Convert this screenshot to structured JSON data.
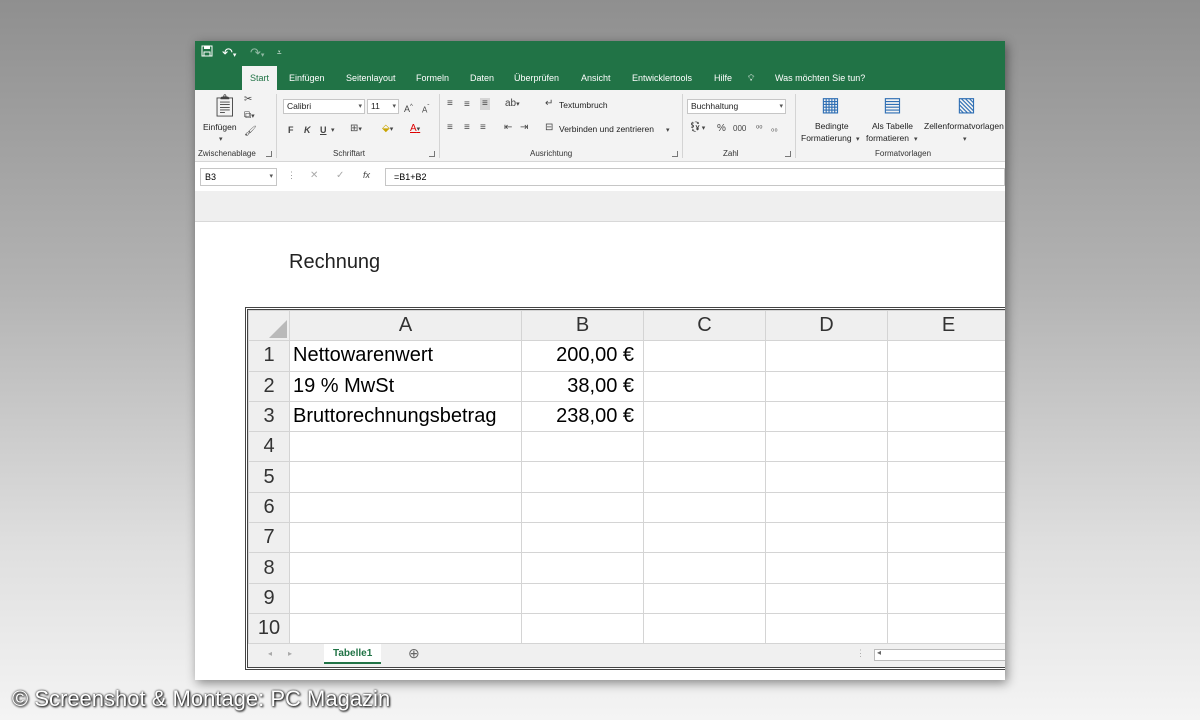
{
  "quick_access": {
    "save_icon": "save-icon",
    "undo_icon": "undo-icon",
    "redo_icon": "redo-icon",
    "customize_icon": "customize-icon"
  },
  "tabs": [
    {
      "label": "Start",
      "active": true
    },
    {
      "label": "Einfügen"
    },
    {
      "label": "Seitenlayout"
    },
    {
      "label": "Formeln"
    },
    {
      "label": "Daten"
    },
    {
      "label": "Überprüfen"
    },
    {
      "label": "Ansicht"
    },
    {
      "label": "Entwicklertools"
    },
    {
      "label": "Hilfe"
    }
  ],
  "tell_me": "Was möchten Sie tun?",
  "ribbon": {
    "clipboard": {
      "paste_label": "Einfügen",
      "group_label": "Zwischenablage"
    },
    "font": {
      "name": "Calibri",
      "size": "11",
      "bold": "F",
      "italic": "K",
      "underline": "U",
      "group_label": "Schriftart"
    },
    "alignment": {
      "wrap_label": "Textumbruch",
      "merge_label": "Verbinden und zentrieren",
      "group_label": "Ausrichtung"
    },
    "number": {
      "format": "Buchhaltung",
      "percent": "%",
      "thousands": "000",
      "group_label": "Zahl"
    },
    "styles": {
      "cond_format_line1": "Bedingte",
      "cond_format_line2": "Formatierung",
      "table_line1": "Als Tabelle",
      "table_line2": "formatieren",
      "cell_styles": "Zellenformatvorlagen",
      "group_label": "Formatvorlagen"
    }
  },
  "formula_bar": {
    "name_box": "B3",
    "cancel": "✕",
    "enter": "✓",
    "fx": "fx",
    "formula": "=B1+B2"
  },
  "document_title": "Rechnung",
  "sheet": {
    "columns": [
      "A",
      "B",
      "C",
      "D",
      "E"
    ],
    "rows": [
      {
        "n": "1",
        "a": "Nettowarenwert",
        "b": "200,00 €"
      },
      {
        "n": "2",
        "a": "19 % MwSt",
        "b": "38,00 €"
      },
      {
        "n": "3",
        "a": "Bruttorechnungsbetrag",
        "b": "238,00 €"
      },
      {
        "n": "4",
        "a": "",
        "b": ""
      },
      {
        "n": "5",
        "a": "",
        "b": ""
      },
      {
        "n": "6",
        "a": "",
        "b": ""
      },
      {
        "n": "7",
        "a": "",
        "b": ""
      },
      {
        "n": "8",
        "a": "",
        "b": ""
      },
      {
        "n": "9",
        "a": "",
        "b": ""
      },
      {
        "n": "10",
        "a": "",
        "b": ""
      }
    ],
    "active_tab": "Tabelle1",
    "add_sheet": "⊕"
  },
  "copyright": "© Screenshot & Montage: PC Magazin"
}
